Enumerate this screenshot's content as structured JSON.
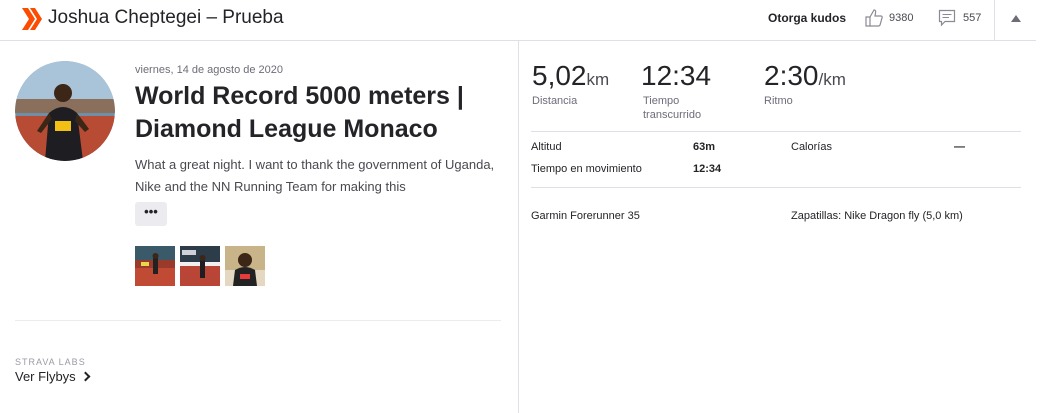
{
  "header": {
    "title": "Joshua Cheptegei – Prueba",
    "kudos_label": "Otorga kudos",
    "kudos_count": "9380",
    "comments_count": "557",
    "icons": {
      "logo": "strava-chevrons-icon",
      "kudos": "thumbs-up-icon",
      "comments": "comment-icon",
      "collapse": "caret-up-icon"
    },
    "brand_color": "#fc4c02"
  },
  "activity": {
    "date": "viernes, 14 de agosto de 2020",
    "title": "World Record 5000 meters | Diamond League Monaco",
    "description": "What a great night. I want to thank the government of Uganda, Nike and the NN Running Team for making this",
    "more_label": "•••",
    "photos": [
      "photo-1",
      "photo-2",
      "photo-3"
    ]
  },
  "labs": {
    "label": "STRAVA LABS",
    "link": "Ver Flybys"
  },
  "stats": {
    "distance": {
      "value": "5,02",
      "unit": "km",
      "label": "Distancia"
    },
    "elapsed": {
      "value": "12:34",
      "label_1": "Tiempo",
      "label_2": "transcurrido"
    },
    "pace": {
      "value": "2:30",
      "unit": "/km",
      "label": "Ritmo"
    }
  },
  "details": {
    "elevation_label": "Altitud",
    "elevation_value": "63m",
    "calories_label": "Calorías",
    "calories_value": "—",
    "moving_label": "Tiempo en movimiento",
    "moving_value": "12:34"
  },
  "gear": {
    "device": "Garmin Forerunner 35",
    "shoes": "Zapatillas: Nike Dragon fly (5,0 km)"
  }
}
